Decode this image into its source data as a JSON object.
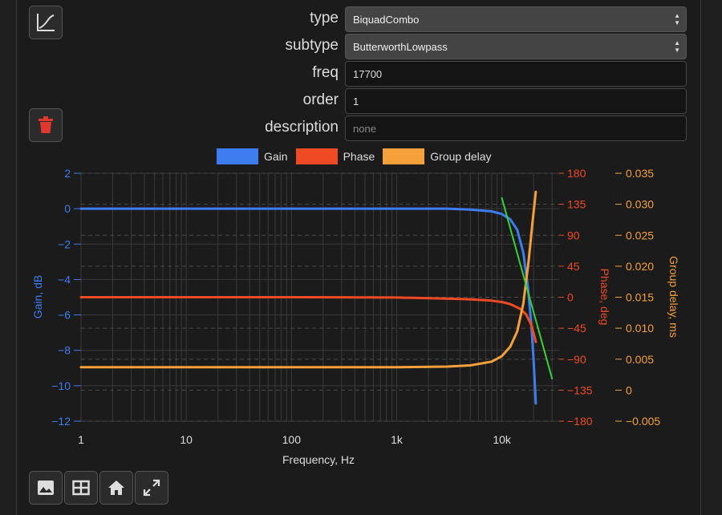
{
  "form": {
    "fields": [
      {
        "label": "type",
        "value": "BiquadCombo",
        "kind": "select"
      },
      {
        "label": "subtype",
        "value": "ButterworthLowpass",
        "kind": "select"
      },
      {
        "label": "freq",
        "value": "17700",
        "kind": "input"
      },
      {
        "label": "order",
        "value": "1",
        "kind": "input"
      },
      {
        "label": "description",
        "value": "none",
        "kind": "placeholder"
      }
    ]
  },
  "buttons": {
    "plot_icon": "chart-line-icon",
    "delete_icon": "trash-icon",
    "toolbar": [
      "image-icon",
      "table-icon",
      "home-icon",
      "expand-icon"
    ]
  },
  "colors": {
    "gain": "#3d7df0",
    "phase": "#f04a25",
    "group_delay": "#f5a03a",
    "extra_line": "#39d23a",
    "delete": "#e0382f"
  },
  "chart_data": {
    "type": "line",
    "xlabel": "Frequency, Hz",
    "x_scale": "log",
    "x_ticks": [
      "1",
      "10",
      "100",
      "1k",
      "10k"
    ],
    "x_tick_values": [
      1,
      10,
      100,
      1000,
      10000
    ],
    "xlim": [
      1,
      35000
    ],
    "axes": {
      "gain": {
        "label": "Gain, dB",
        "ylim": [
          -12,
          2
        ],
        "ticks": [
          2,
          0,
          -2,
          -4,
          -6,
          -8,
          -10,
          -12
        ]
      },
      "phase": {
        "label": "Phase, deg",
        "ylim": [
          -180,
          180
        ],
        "ticks": [
          180,
          135,
          90,
          45,
          0,
          -45,
          -90,
          -135,
          -180
        ]
      },
      "group_delay": {
        "label": "Group delay, ms",
        "ylim": [
          -0.005,
          0.035
        ],
        "ticks": [
          "0.035",
          "0.030",
          "0.025",
          "0.020",
          "0.015",
          "0.010",
          "0.005",
          "0",
          "-0.005"
        ]
      }
    },
    "legend": [
      "Gain",
      "Phase",
      "Group delay"
    ],
    "legend_position": "top",
    "grid": true,
    "series": [
      {
        "name": "Gain",
        "axis": "gain",
        "x": [
          1,
          10,
          100,
          1000,
          3000,
          5000,
          8000,
          10000,
          12000,
          14000,
          16000,
          17700,
          19000,
          20000,
          21000
        ],
        "y": [
          0,
          0,
          0,
          0,
          0,
          -0.05,
          -0.15,
          -0.3,
          -0.6,
          -1.2,
          -2.5,
          -4.5,
          -6.5,
          -8.5,
          -11
        ]
      },
      {
        "name": "Phase",
        "axis": "phase",
        "x": [
          1,
          10,
          100,
          1000,
          3000,
          5000,
          8000,
          10000,
          12000,
          15000,
          17000,
          19000,
          20000,
          21000
        ],
        "y": [
          0,
          0,
          0,
          -0.5,
          -2,
          -3,
          -5,
          -7,
          -10,
          -17,
          -25,
          -40,
          -52,
          -65
        ]
      },
      {
        "name": "Group delay",
        "axis": "group_delay",
        "x": [
          1,
          10,
          100,
          1000,
          3000,
          5000,
          8000,
          10000,
          12000,
          14000,
          16000,
          18000,
          19500,
          21000
        ],
        "y": [
          0.0037,
          0.0037,
          0.0037,
          0.0037,
          0.0038,
          0.004,
          0.0046,
          0.0055,
          0.007,
          0.0095,
          0.014,
          0.021,
          0.027,
          0.032
        ]
      },
      {
        "axis": "gain",
        "x": [
          10000,
          30000
        ],
        "y": [
          0.6,
          -9.6
        ]
      }
    ]
  }
}
